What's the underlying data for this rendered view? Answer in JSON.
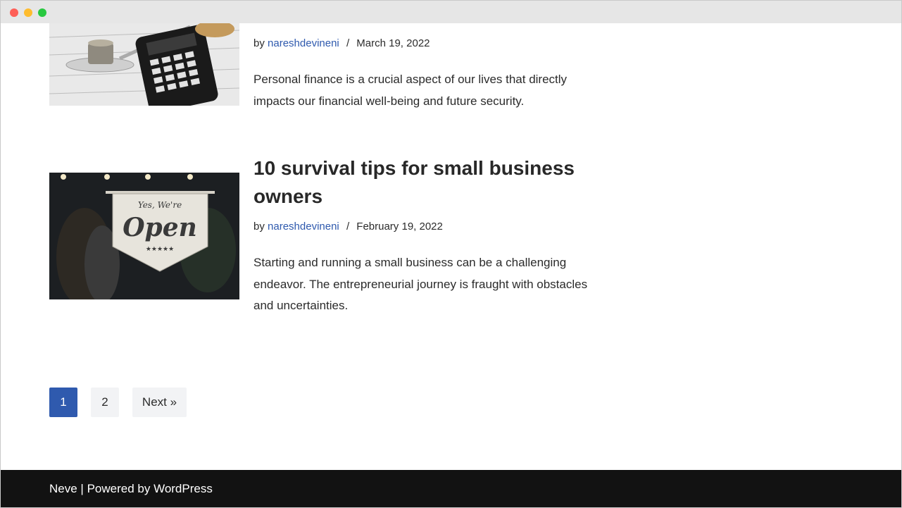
{
  "posts": [
    {
      "author_prefix": "by",
      "author": "nareshdevineni",
      "separator": "/",
      "date": "March 19, 2022",
      "excerpt": "Personal finance is a crucial aspect of our lives that directly impacts our financial well-being and future security."
    },
    {
      "title": "10 survival tips for small business owners",
      "author_prefix": "by",
      "author": "nareshdevineni",
      "separator": "/",
      "date": "February 19, 2022",
      "excerpt": "Starting and running a small business can be a challenging endeavor. The entrepreneurial journey is fraught with obstacles and uncertainties.",
      "image_sign": {
        "top_text": "Yes, We're",
        "main_text": "Open",
        "stars": "★★★★★"
      }
    }
  ],
  "pagination": {
    "pages": [
      "1",
      "2"
    ],
    "current": "1",
    "next": "Next »"
  },
  "footer": {
    "theme": "Neve",
    "divider": "|",
    "powered": "Powered by WordPress"
  },
  "colors": {
    "link": "#2f5aae",
    "footer_bg": "#121212",
    "active_page": "#2f5aae"
  }
}
